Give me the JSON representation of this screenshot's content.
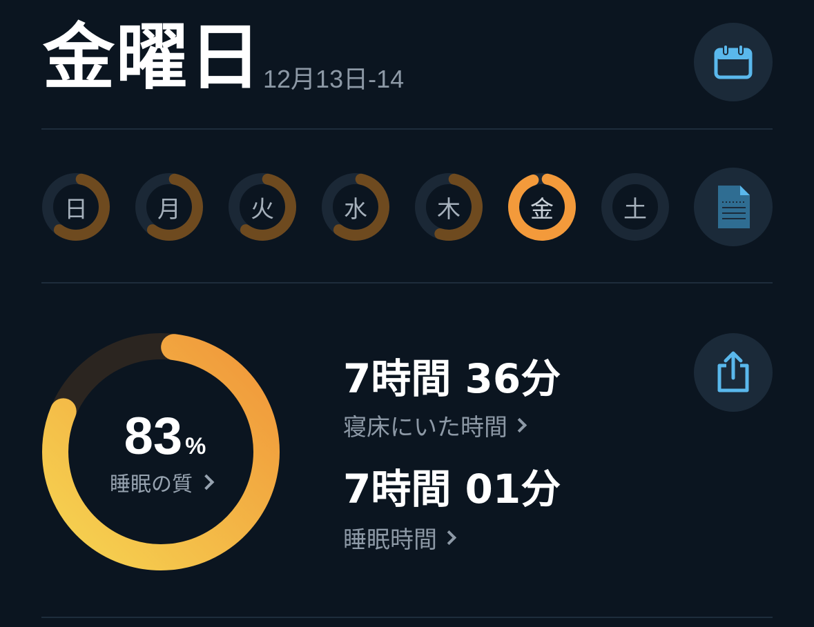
{
  "header": {
    "title": "金曜日",
    "date_range": "12月13日-14"
  },
  "week": {
    "days": [
      {
        "label": "日",
        "state": "recorded",
        "progress": 0.6
      },
      {
        "label": "月",
        "state": "recorded",
        "progress": 0.6
      },
      {
        "label": "火",
        "state": "recorded",
        "progress": 0.6
      },
      {
        "label": "水",
        "state": "recorded",
        "progress": 0.6
      },
      {
        "label": "木",
        "state": "recorded",
        "progress": 0.55
      },
      {
        "label": "金",
        "state": "selected",
        "progress": 0.95
      },
      {
        "label": "土",
        "state": "empty",
        "progress": 0
      }
    ]
  },
  "quality": {
    "percent_value": "83",
    "percent_unit": "%",
    "label": "睡眠の質",
    "fraction": 0.83
  },
  "stats": {
    "in_bed_value": "7時間 36分",
    "in_bed_label": "寝床にいた時間",
    "sleep_value": "7時間 01分",
    "sleep_label": "睡眠時間"
  },
  "icons": {
    "calendar": "calendar-icon",
    "notes": "document-icon",
    "share": "share-icon"
  },
  "colors": {
    "background": "#0b1520",
    "accent_orange": "#f39a3b",
    "dim_orange": "#6e4a1f",
    "ring_track": "#1b2836",
    "icon_blue": "#5ab8ec",
    "gradient_yellow": "#f6d451"
  }
}
